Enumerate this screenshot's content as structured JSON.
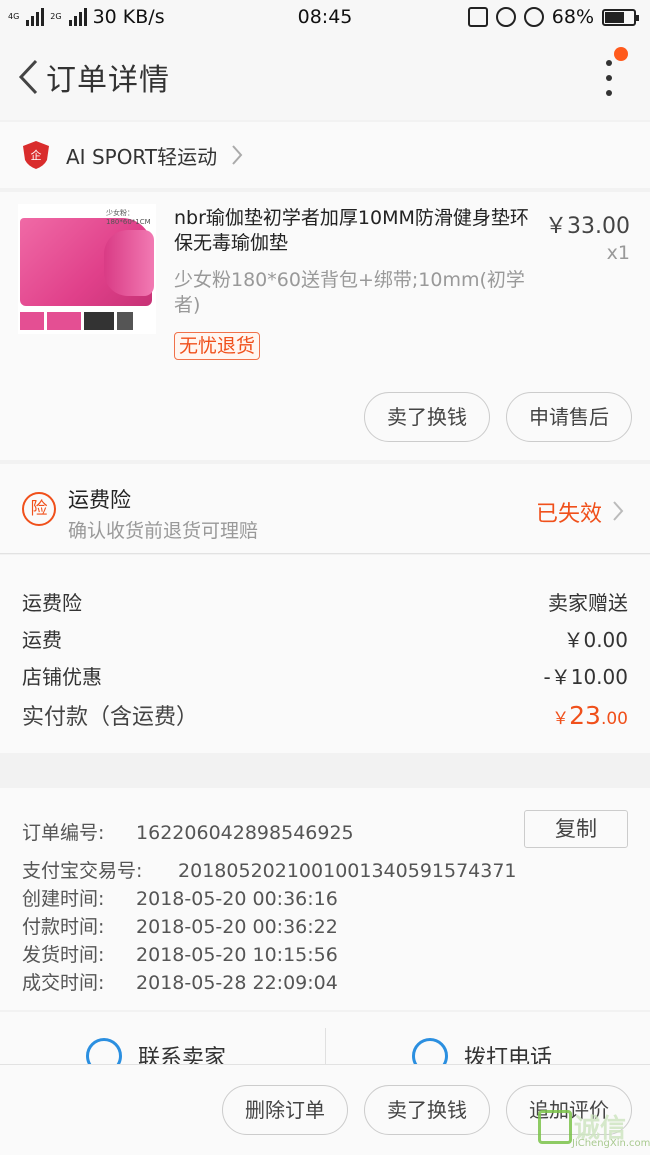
{
  "status_bar": {
    "network_a": "4G",
    "network_b": "2G",
    "speed": "30 KB/s",
    "time": "08:45",
    "battery": "68%",
    "battery_level": 0.68
  },
  "nav": {
    "title": "订单详情"
  },
  "shop": {
    "name": "AI SPORT轻运动"
  },
  "product": {
    "image_caption": "少女粉：180*60*1CM",
    "title": "nbr瑜伽垫初学者加厚10MM防滑健身垫环保无毒瑜伽垫",
    "sku": "少女粉180*60送背包+绑带;10mm(初学者)",
    "tag": "无忧退货",
    "price": "￥33.00",
    "qty": "x1",
    "buttons": {
      "sell": "卖了换钱",
      "after_sale": "申请售后"
    }
  },
  "insurance": {
    "icon_char": "险",
    "title": "运费险",
    "subtitle": "确认收货前退货可理赔",
    "status": "已失效"
  },
  "fees": [
    {
      "label": "运费险",
      "value": "卖家赠送"
    },
    {
      "label": "运费",
      "value": "￥0.00"
    },
    {
      "label": "店铺优惠",
      "value": "-￥10.00"
    }
  ],
  "total": {
    "label": "实付款（含运费）",
    "currency": "￥",
    "int": "23",
    "dec": ".00"
  },
  "order_info": {
    "copy_label": "复制",
    "rows": [
      {
        "label": "订单编号:",
        "value": "162206042898546925"
      },
      {
        "label": "支付宝交易号:",
        "value": "2018052021001001340591574371"
      },
      {
        "label": "创建时间:",
        "value": "2018-05-20 00:36:16"
      },
      {
        "label": "付款时间:",
        "value": "2018-05-20 00:36:22"
      },
      {
        "label": "发货时间:",
        "value": "2018-05-20 10:15:56"
      },
      {
        "label": "成交时间:",
        "value": "2018-05-28 22:09:04"
      }
    ]
  },
  "contact": {
    "seller": "联系卖家",
    "phone": "拨打电话"
  },
  "bottom_actions": {
    "delete": "删除订单",
    "sell": "卖了换钱",
    "review": "追加评价"
  },
  "watermark": {
    "text": "诚信",
    "sub": "JiChengXin.com"
  }
}
